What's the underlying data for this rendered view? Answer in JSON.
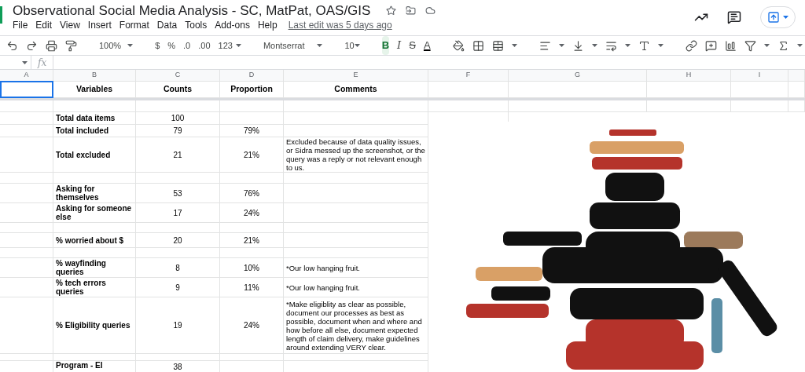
{
  "document": {
    "title": "Observational Social Media Analysis - SC, MatPat, OAS/GIS",
    "last_edit": "Last edit was 5 days ago"
  },
  "menu": [
    "File",
    "Edit",
    "View",
    "Insert",
    "Format",
    "Data",
    "Tools",
    "Add-ons",
    "Help"
  ],
  "toolbar": {
    "zoom": "100%",
    "currency": "$",
    "percent": "%",
    "decimal_decrease": ".0",
    "decimal_increase": ".00",
    "number_format": "123",
    "font": "Montserrat",
    "font_size": "10",
    "text_styles": [
      {
        "label": "B",
        "kind": "bold",
        "selected": true
      },
      {
        "label": "I",
        "kind": "italic",
        "selected": false
      },
      {
        "label": "S",
        "kind": "strike",
        "selected": false
      },
      {
        "label": "A",
        "kind": "color",
        "selected": false
      }
    ]
  },
  "formula_bar": {
    "fx_label": "fx"
  },
  "columns": [
    "A",
    "B",
    "C",
    "D",
    "E",
    "F",
    "G",
    "H",
    "I"
  ],
  "header": {
    "a_selected": true,
    "variable": "Variables",
    "count": "Counts",
    "proportion": "Proportion",
    "comment": "Comments"
  },
  "rows": [
    {
      "kind": "blank"
    },
    {
      "kind": "data",
      "variable": "Total data items",
      "count": "100"
    },
    {
      "kind": "data",
      "variable": "Total included",
      "count": "79",
      "proportion": "79%"
    },
    {
      "kind": "data",
      "variable": "Total excluded",
      "count": "21",
      "proportion": "21%",
      "comment": "Excluded because of data quality issues, or Sidra messed up the screenshot, or the query was a reply or not relevant enough to us."
    },
    {
      "kind": "blank"
    },
    {
      "kind": "data",
      "variable": "Asking for themselves",
      "count": "53",
      "proportion": "76%"
    },
    {
      "kind": "data",
      "variable": "Asking for someone else",
      "count": "17",
      "proportion": "24%"
    },
    {
      "kind": "blank"
    },
    {
      "kind": "data",
      "variable": "% worried about $",
      "count": "20",
      "proportion": "21%"
    },
    {
      "kind": "blank"
    },
    {
      "kind": "data",
      "variable": "% wayfinding queries",
      "count": "8",
      "proportion": "10%",
      "comment": "*Our low hanging fruit."
    },
    {
      "kind": "data",
      "variable": "% tech errors queries",
      "count": "9",
      "proportion": "11%",
      "comment": "*Our low hanging fruit."
    },
    {
      "kind": "data",
      "variable": "% Eligibility queries",
      "count": "19",
      "proportion": "24%",
      "comment": "*Make eligiblity as clear as possible, document our processes as best as possible, document when and where and how before all else, document expected length of claim delivery, make guidelines around extending VERY clear."
    },
    {
      "kind": "blank"
    },
    {
      "kind": "data",
      "variable": "Program - EI",
      "count": "38"
    }
  ]
}
